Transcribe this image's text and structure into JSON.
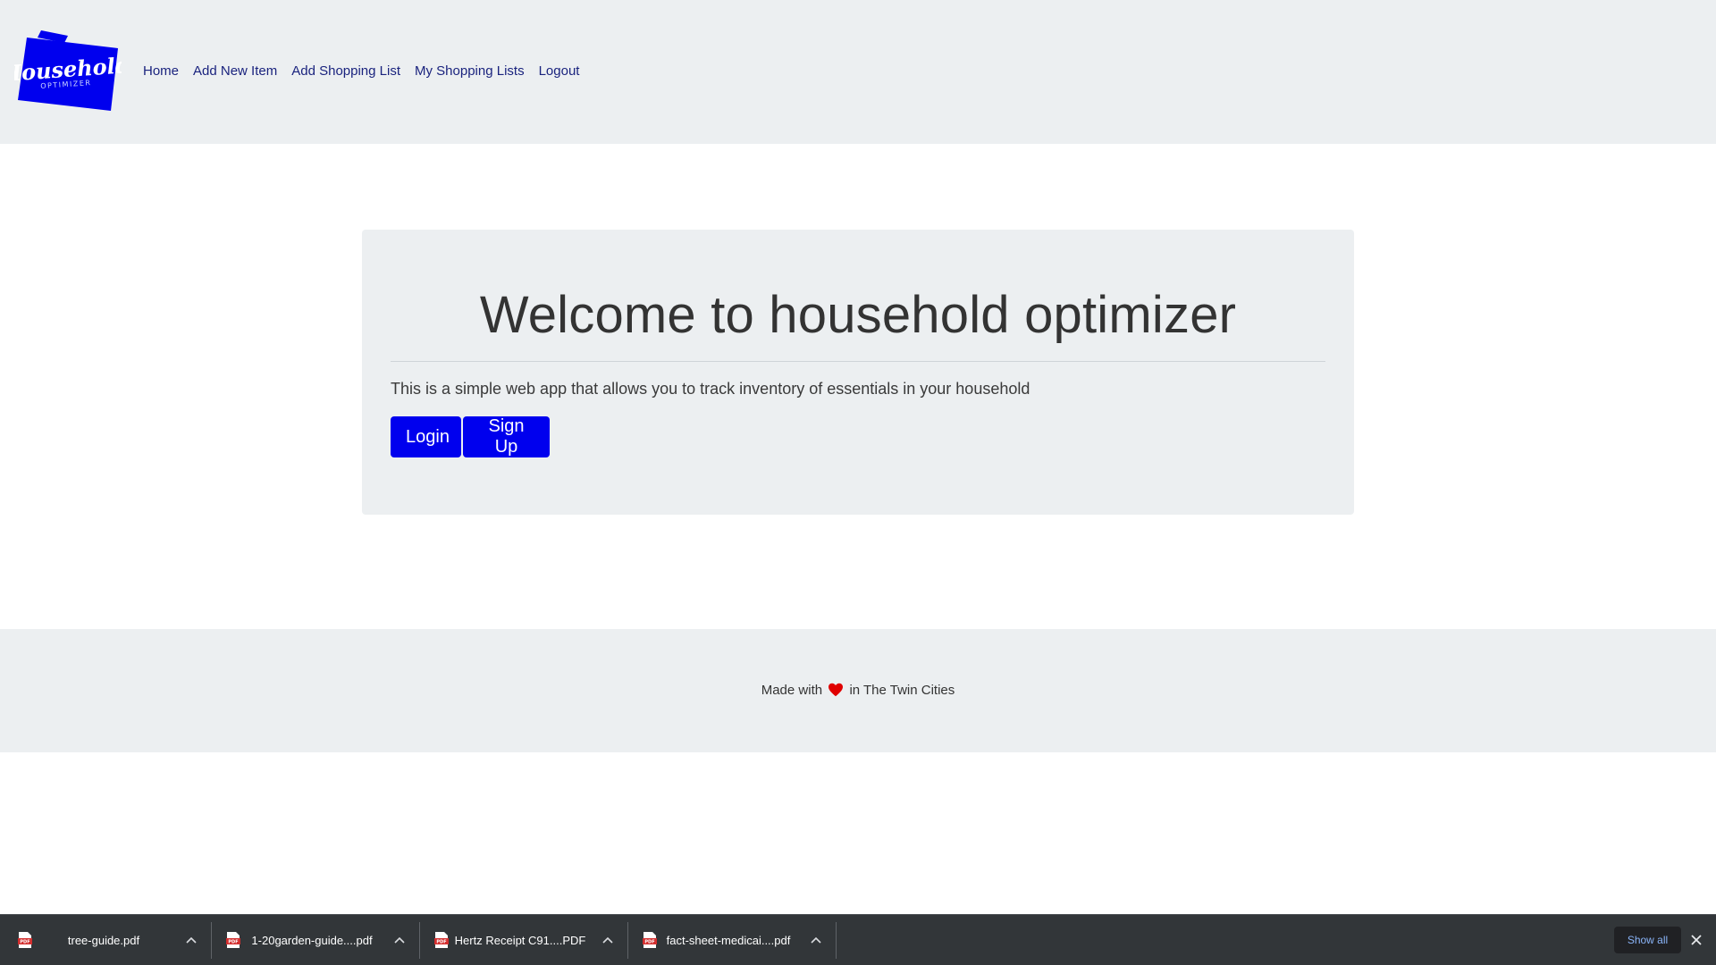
{
  "header": {
    "logo_word": "Household",
    "logo_sub": "OPTIMIZER",
    "nav": [
      {
        "label": "Home"
      },
      {
        "label": "Add New Item"
      },
      {
        "label": "Add Shopping List"
      },
      {
        "label": "My Shopping Lists"
      },
      {
        "label": "Logout"
      }
    ]
  },
  "hero": {
    "title": "Welcome to household optimizer",
    "description": "This is a simple web app that allows you to track inventory of essentials in your household",
    "login_label": "Login",
    "signup_label": "Sign Up"
  },
  "footer": {
    "text_before": "Made with",
    "text_after": "in The Twin Cities"
  },
  "downloads": {
    "items": [
      {
        "name": "tree-guide.pdf"
      },
      {
        "name": "1-20garden-guide....pdf"
      },
      {
        "name": "Hertz Receipt C91....PDF"
      },
      {
        "name": "fact-sheet-medicai....pdf"
      }
    ],
    "show_all_label": "Show all"
  },
  "colors": {
    "brand_blue": "#0000ee",
    "nav_link": "#1a237e",
    "panel_bg": "#eceff1",
    "heart": "#e00000",
    "download_bar": "#323639"
  }
}
